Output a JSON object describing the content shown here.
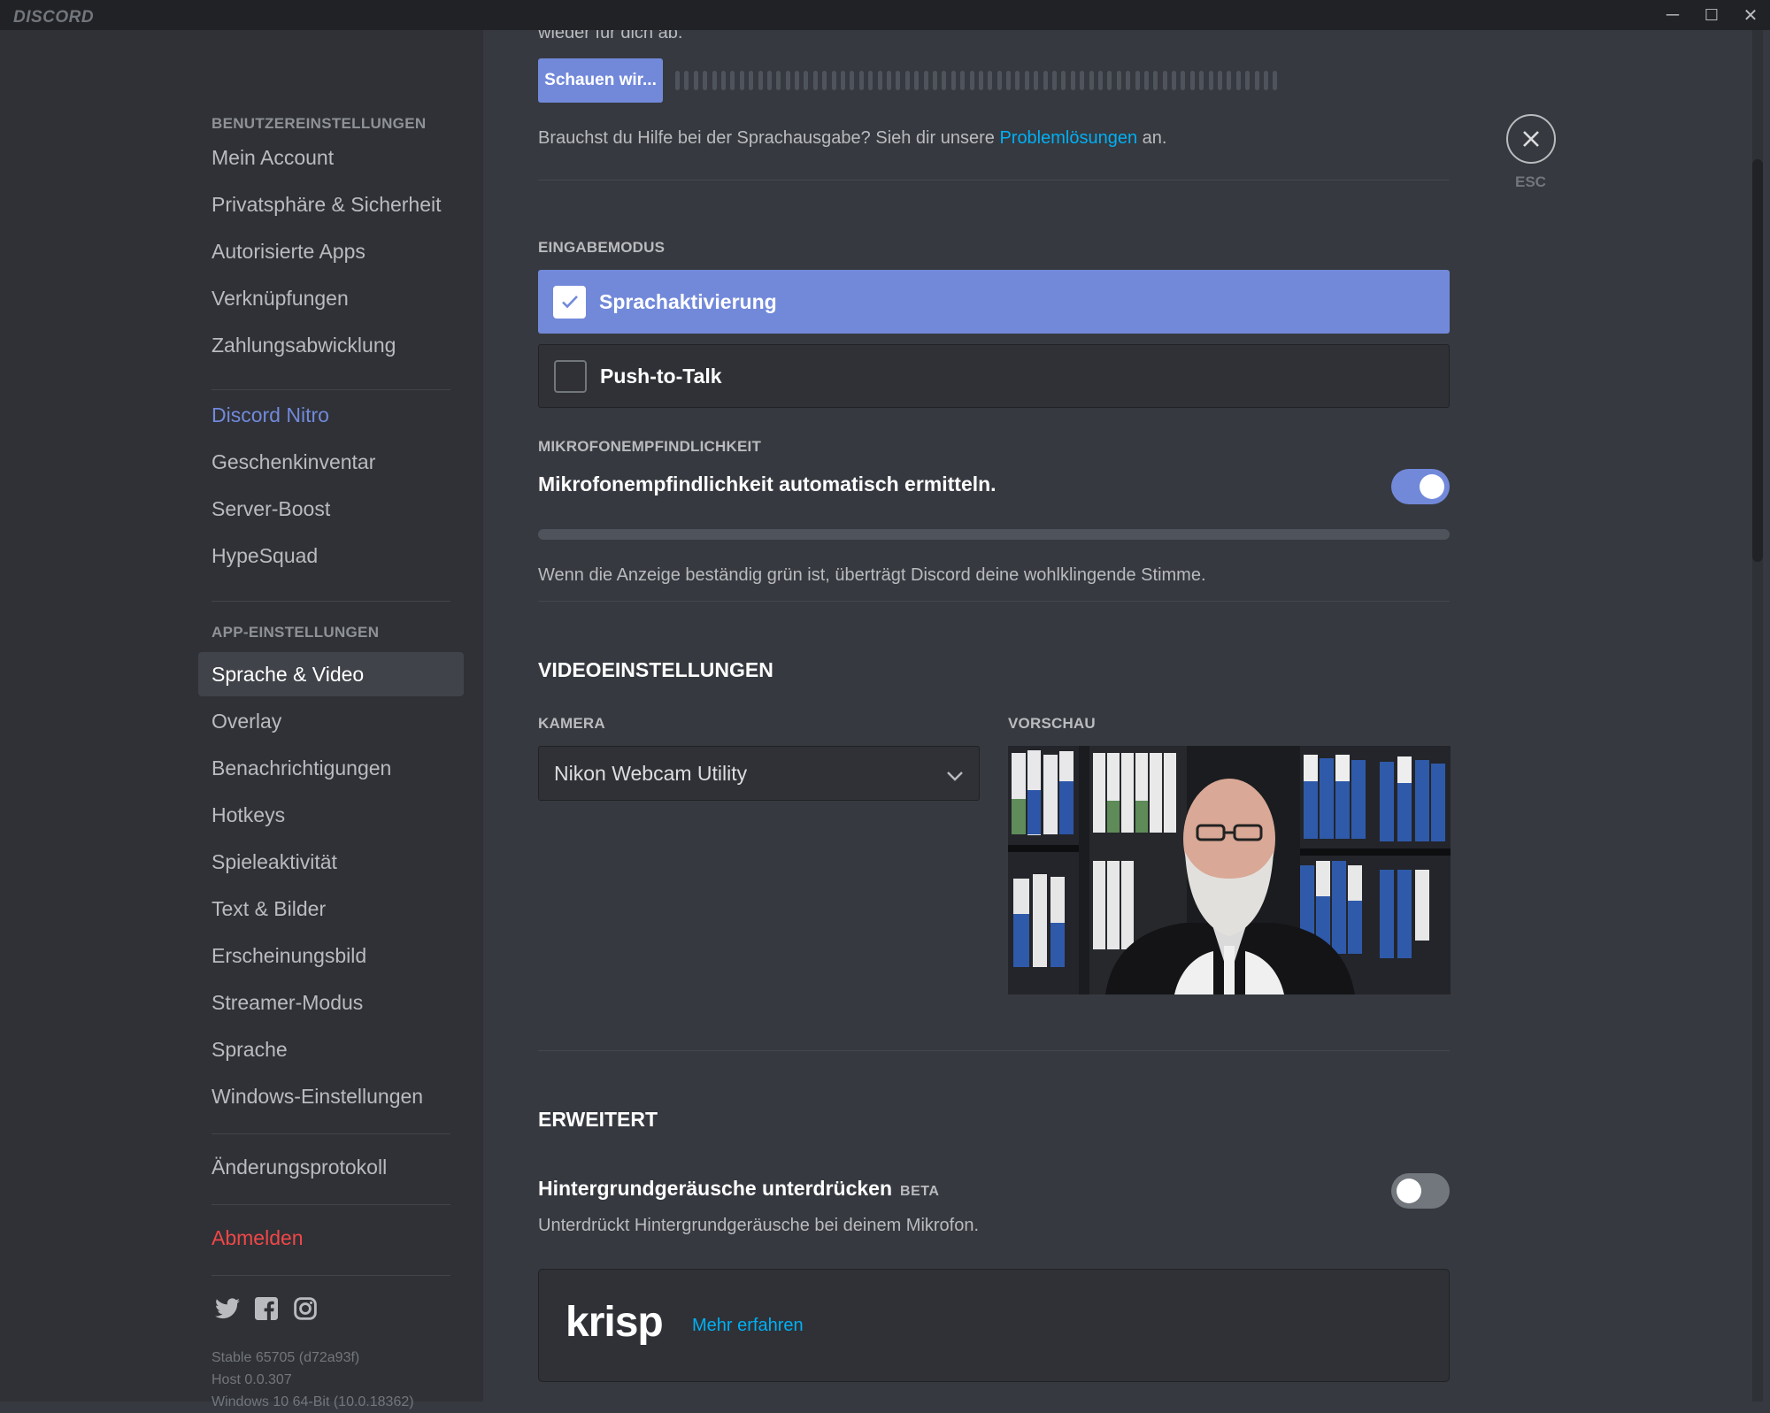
{
  "app": {
    "title": "DISCORD"
  },
  "window_controls": {
    "minimize": "─",
    "maximize": "☐",
    "close": "✕"
  },
  "sidebar": {
    "user_settings_head": "BENUTZEREINSTELLUNGEN",
    "user_items": [
      "Mein Account",
      "Privatsphäre & Sicherheit",
      "Autorisierte Apps",
      "Verknüpfungen",
      "Zahlungsabwicklung"
    ],
    "nitro_items": [
      "Discord Nitro",
      "Geschenkinventar",
      "Server-Boost",
      "HypeSquad"
    ],
    "app_settings_head": "APP-EINSTELLUNGEN",
    "app_items": [
      "Sprache & Video",
      "Overlay",
      "Benachrichtigungen",
      "Hotkeys",
      "Spieleaktivität",
      "Text & Bilder",
      "Erscheinungsbild",
      "Streamer-Modus",
      "Sprache",
      "Windows-Einstellungen"
    ],
    "changelog": "Änderungsprotokoll",
    "logout": "Abmelden",
    "social_icons": [
      "twitter-icon",
      "facebook-icon",
      "instagram-icon"
    ],
    "version_lines": [
      "Stable 65705 (d72a93f)",
      "Host 0.0.307",
      "Windows 10 64-Bit (10.0.18362)"
    ]
  },
  "main": {
    "top_text": "wieder für dich ab.",
    "check_button": "Schauen wir...",
    "help_text_before": "Brauchst du Hilfe bei der Sprachausgabe? Sieh dir unsere ",
    "help_link": "Problemlösungen",
    "help_text_after": " an.",
    "input_mode_head": "EINGABEMODUS",
    "input_mode_selected": "Sprachaktivierung",
    "input_mode_other": "Push-to-Talk",
    "sensitivity_head": "MIKROFONEMPFINDLICHKEIT",
    "sensitivity_label": "Mikrofonempfindlichkeit automatisch ermitteln.",
    "sensitivity_auto": true,
    "sensitivity_hint": "Wenn die Anzeige beständig grün ist, überträgt Discord deine wohlklingende Stimme.",
    "video_head": "VIDEOEINSTELLUNGEN",
    "camera_head": "KAMERA",
    "camera_value": "Nikon Webcam Utility",
    "preview_head": "VORSCHAU",
    "advanced_head": "ERWEITERT",
    "noise_label": "Hintergrundgeräusche unterdrücken",
    "noise_badge": "BETA",
    "noise_enabled": false,
    "noise_desc": "Unterdrückt Hintergrundgeräusche bei deinem Mikrofon.",
    "krisp_logo": "krisp",
    "krisp_link": "Mehr erfahren"
  },
  "close": {
    "label": "ESC",
    "icon": "close-icon"
  },
  "colors": {
    "accent": "#7289da",
    "danger": "#f04747",
    "link": "#00b0f4"
  }
}
